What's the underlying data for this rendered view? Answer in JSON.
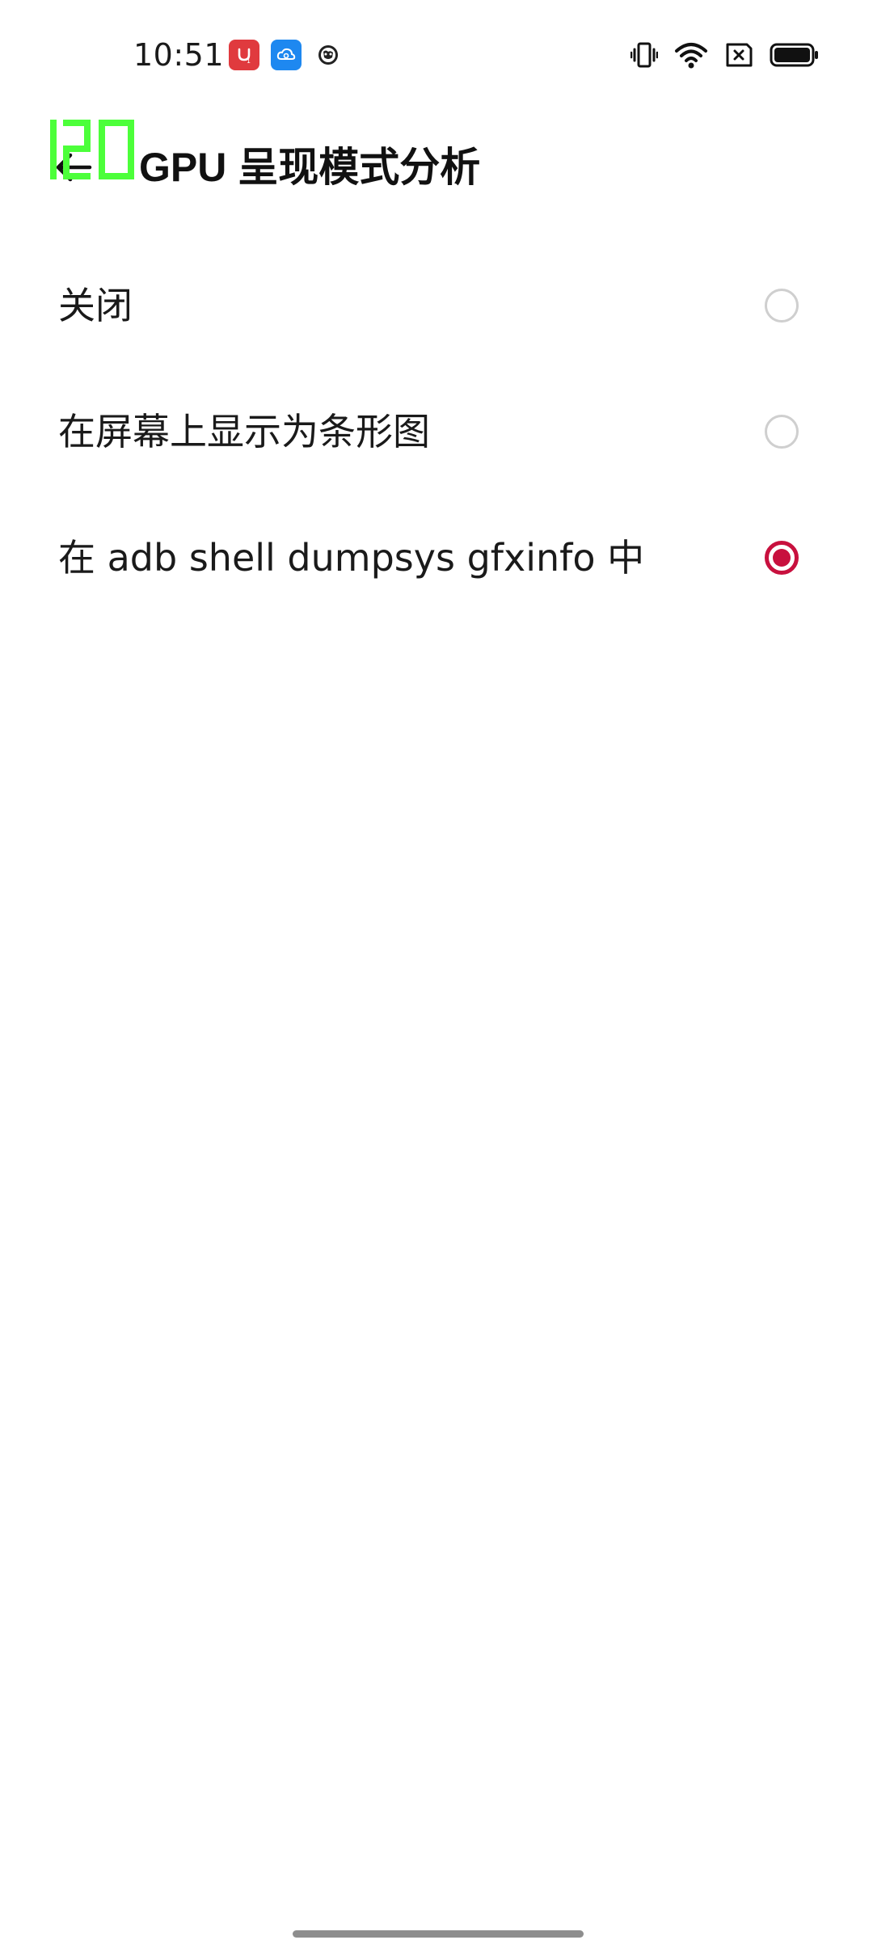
{
  "status_bar": {
    "time": "10:51",
    "notification_icons": [
      "shopping-bag-app-icon",
      "cloud-app-icon",
      "globe-app-icon"
    ],
    "system_icons": [
      "vibrate-icon",
      "wifi-icon",
      "no-sim-icon",
      "battery-icon"
    ]
  },
  "fps_overlay": {
    "value": "120",
    "color": "#4cff3a"
  },
  "header": {
    "title": "GPU 呈现模式分析",
    "back_icon": "back-arrow-icon"
  },
  "options": [
    {
      "label": "关闭",
      "selected": false
    },
    {
      "label": "在屏幕上显示为条形图",
      "selected": false
    },
    {
      "label": "在 adb shell dumpsys gfxinfo 中",
      "selected": true
    }
  ],
  "colors": {
    "accent": "#c8103e",
    "radio_unchecked": "#cfcfcf",
    "text": "#1a1a1a"
  }
}
